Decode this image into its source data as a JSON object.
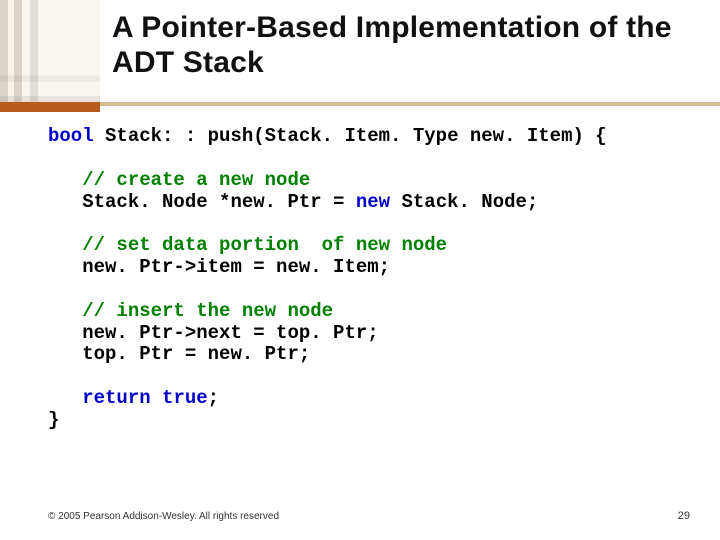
{
  "title": "A Pointer-Based Implementation of the ADT Stack",
  "code": {
    "sig_pre": "bool",
    "sig_rest": " Stack: : push(Stack. Item. Type new. Item) {",
    "c1": "// create a new node",
    "l1a": "Stack. Node *new. Ptr = ",
    "l1kw": "new",
    "l1b": " Stack. Node;",
    "c2": "// set data portion  of new node",
    "l2": "new. Ptr->item = new. Item;",
    "c3": "// insert the new node",
    "l3": "new. Ptr->next = top. Ptr;",
    "l4": "top. Ptr = new. Ptr;",
    "retkw": "return",
    "retsp": " ",
    "retval": "true",
    "retend": ";",
    "close": "}"
  },
  "footer": {
    "copyright": "© 2005 Pearson Addison-Wesley. All rights reserved",
    "page": "29"
  }
}
